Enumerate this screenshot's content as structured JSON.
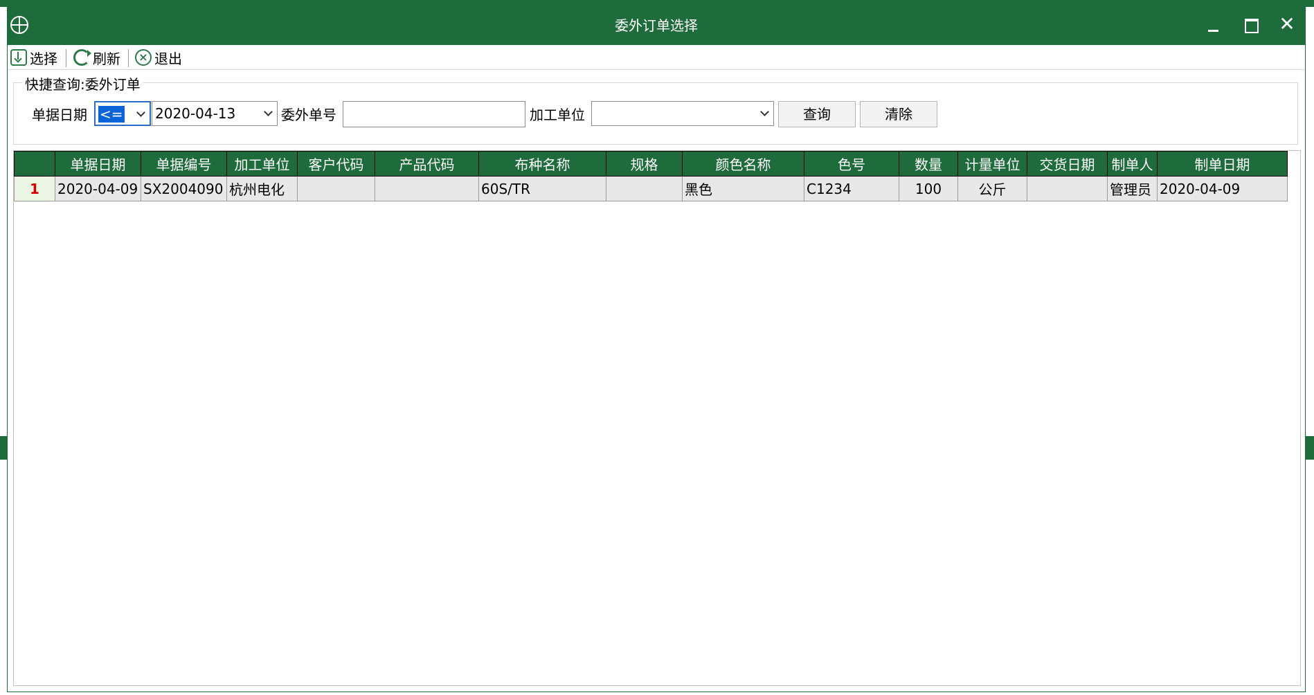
{
  "window": {
    "title": "委外订单选择"
  },
  "toolbar": {
    "select_label": "选择",
    "refresh_label": "刷新",
    "exit_label": "退出"
  },
  "query": {
    "group_title": "快捷查询:委外订单",
    "date_label": "单据日期",
    "date_operator": "<=",
    "date_value": "2020-04-13",
    "order_no_label": "委外单号",
    "order_no_value": "",
    "processor_label": "加工单位",
    "processor_value": "",
    "search_label": "查询",
    "clear_label": "清除"
  },
  "grid": {
    "columns": [
      "单据日期",
      "单据编号",
      "加工单位",
      "客户代码",
      "产品代码",
      "布种名称",
      "规格",
      "颜色名称",
      "色号",
      "数量",
      "计量单位",
      "交货日期",
      "制单人",
      "制单日期"
    ],
    "rows": [
      {
        "num": "1",
        "doc_date": "2020-04-09",
        "doc_no": "SX2004090",
        "processor": "杭州电化",
        "customer_code": "",
        "product_code": "",
        "fabric_name": "60S/TR",
        "spec": "",
        "color_name": "黑色",
        "color_no": "C1234",
        "qty": "100",
        "unit": "公斤",
        "delivery_date": "",
        "creator": "管理员",
        "created_date": "2020-04-09"
      }
    ]
  },
  "colors": {
    "primary_green": "#1e6b3c",
    "row_number_red": "#d40000",
    "selection_blue": "#0a64d8"
  }
}
